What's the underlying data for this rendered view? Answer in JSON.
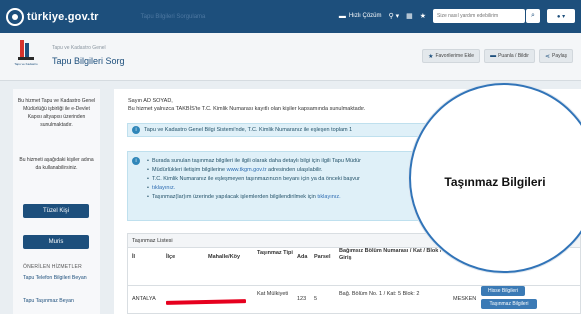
{
  "topbar": {
    "logo_text": "türkiye.gov.tr",
    "ghost_tab": "Tapu Bilgileri Sorgulama",
    "quick_solution": "Hızlı Çözüm",
    "search_placeholder": "Size nasıl yardım edebilirim",
    "colors": {
      "bar": "#1d4f7c"
    }
  },
  "page_header": {
    "institution_caption": "Tapu ve Kadastro",
    "breadcrumb": "Tapu ve Kadastro Genel",
    "title": "Tapu Bilgileri Sorg",
    "buttons": [
      "Favorilerime Ekle",
      "Puanla / Bildir",
      "Paylaş"
    ]
  },
  "sidebar": {
    "text1": "Bu hizmet Tapu ve Kadastro Genel Müdürlüğü işbirliği ile e-Devlet Kapısı altyapısı üzerinden sunulmaktadır.",
    "text2": "Bu hizmeti aşağıdaki kişiler adına da kullanabilirsiniz.",
    "buttons": [
      "Tüzel Kişi",
      "Muris"
    ],
    "section_title": "ÖNERİLEN HİZMETLER",
    "links": [
      "Tapu Telefon Bilgileri Beyan",
      "Tapu Taşınmaz Beyan"
    ]
  },
  "main": {
    "greeting_line1": "Sayın AD SOYAD,",
    "greeting_line2": "Bu hizmet yalnızca TAKBİS'te T.C. Kimlik Numarası kayıtlı olan kişiler kapsamında sunulmaktadır.",
    "info_alert": "Tapu ve Kadastro Genel Bilgi Sistemi'nde, T.C. Kimlik Numaranız ile eşleşen toplam 1",
    "notes": [
      {
        "pre": "Burada sunulan taşınmaz bilgileri ile ilgili olarak daha detaylı bilgi için ilgili Tapu Müdür",
        "link": "",
        "post": ""
      },
      {
        "pre": "Müdürlükleri iletişim bilgilerine ",
        "link": "www.tkgm.gov.tr",
        "post": " adresinden ulaşılabilir."
      },
      {
        "pre": "T.C. Kimlik Numaranız ile eşleşmeyen taşınmazınızın beyanı için ya da önceki başvur",
        "link": "",
        "post": ""
      },
      {
        "pre": "",
        "link": "tıklayınız.",
        "post": ""
      },
      {
        "pre": "Taşınmaz(lar)ım üzerinde yapılacak işlemlerden bilgilendirilmek için ",
        "link": "tıklayınız.",
        "post": ""
      }
    ],
    "table": {
      "caption": "Taşınmaz Listesi",
      "headers": [
        "İl",
        "İlçe",
        "Mahalle/Köy",
        "Taşınmaz Tipi",
        "Ada",
        "Parsel",
        "Bağımsız Bölüm Numarası / Kat / Blok / Giriş",
        "Nitel"
      ],
      "row": {
        "il": "ANTALYA",
        "ilce": "",
        "mahalle": "",
        "tip": "Kat Mülkiyeti",
        "ada": "123",
        "parsel": "5",
        "bagimsiz": "Bağ. Bölüm No. 1 / Kat: 5 Blok: 2",
        "nitelik": "MESKEN"
      },
      "action_buttons": [
        "Hisse Bilgileri",
        "Taşınmaz Bilgileri"
      ]
    }
  },
  "magnifier": {
    "label": "Taşınmaz Bilgileri"
  }
}
